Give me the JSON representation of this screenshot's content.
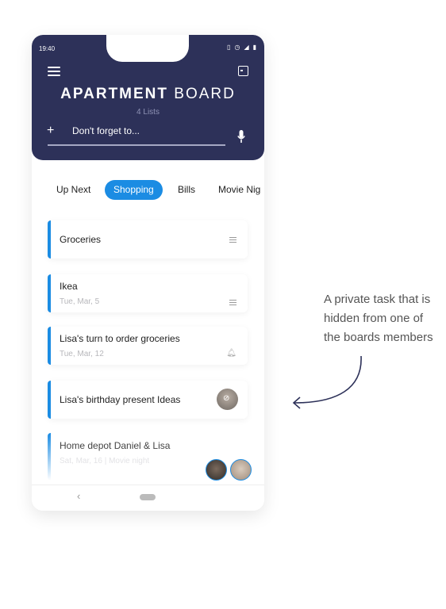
{
  "status": {
    "time": "19:40"
  },
  "header": {
    "title_bold": "APARTMENT",
    "title_light": "BOARD",
    "subtitle": "4 Lists",
    "input_placeholder": "Don't forget to...",
    "add_label": "+"
  },
  "tabs": [
    {
      "label": "Up Next"
    },
    {
      "label": "Shopping",
      "active": true
    },
    {
      "label": "Bills"
    },
    {
      "label": "Movie Nig"
    }
  ],
  "tasks": [
    {
      "title": "Groceries",
      "date": "",
      "icon": "list-icon"
    },
    {
      "title": "Ikea",
      "date": "Tue, Mar, 5",
      "icon": "list-icon"
    },
    {
      "title": "Lisa's turn to order groceries",
      "date": "Tue, Mar, 12",
      "icon": "bell-icon"
    },
    {
      "title": "Lisa's birthday present Ideas",
      "date": "",
      "icon": "hidden-avatar"
    },
    {
      "title": "Home depot Daniel & Lisa",
      "date": "Sat, Mar, 16  | Movie night",
      "icon": "avatars"
    }
  ],
  "nav": {
    "back": "‹"
  },
  "annotation": {
    "text": "A private task that is hidden from one of the boards members"
  },
  "colors": {
    "header": "#2d3159",
    "accent": "#1b8ce3"
  }
}
